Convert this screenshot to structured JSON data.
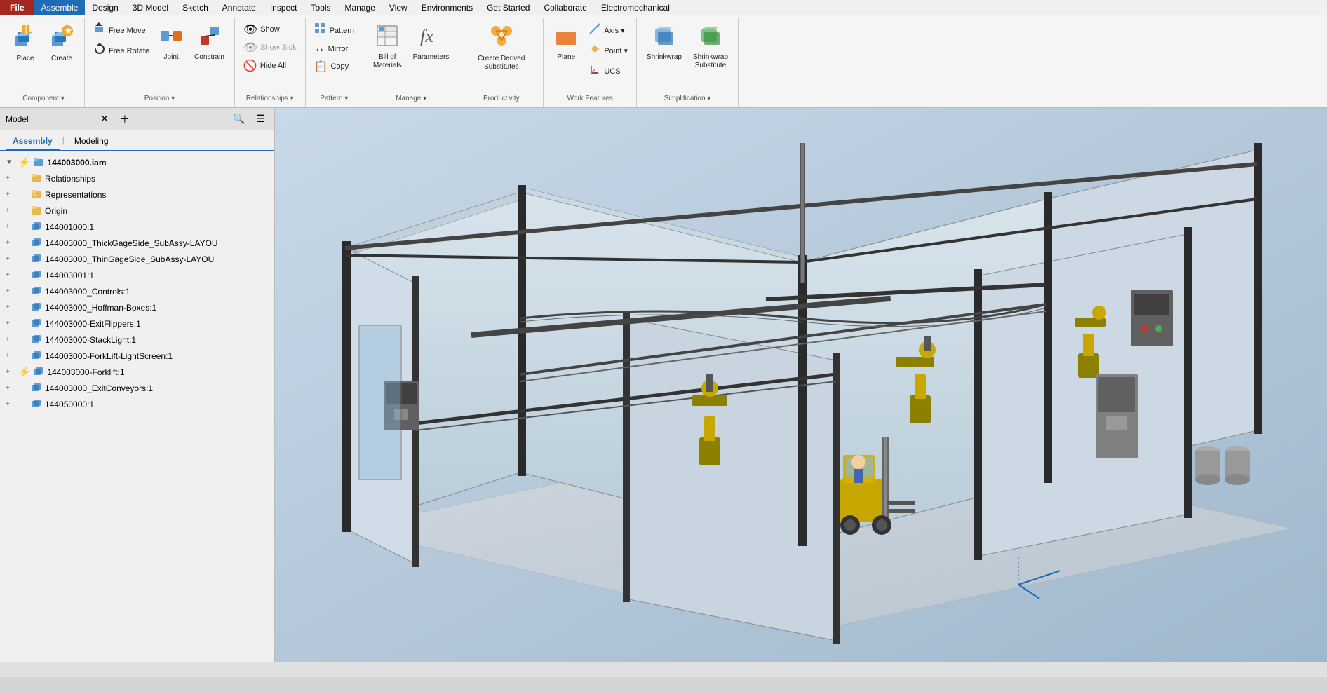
{
  "menubar": {
    "file": "File",
    "items": [
      "Assemble",
      "Design",
      "3D Model",
      "Sketch",
      "Annotate",
      "Inspect",
      "Tools",
      "Manage",
      "View",
      "Environments",
      "Get Started",
      "Collaborate",
      "Electromechanical"
    ],
    "active": "Assemble"
  },
  "ribbon": {
    "groups": [
      {
        "label": "Component",
        "items_large": [
          {
            "id": "place",
            "icon": "📦",
            "label": "Place"
          },
          {
            "id": "create",
            "icon": "✨",
            "label": "Create"
          }
        ],
        "items_small": []
      },
      {
        "label": "Position",
        "items_large": [],
        "items_small": [
          {
            "id": "free-move",
            "icon": "⬆️",
            "label": "Free Move"
          },
          {
            "id": "free-rotate",
            "icon": "🔄",
            "label": "Free Rotate"
          },
          {
            "id": "joint",
            "icon": "🔗",
            "label": "Joint"
          },
          {
            "id": "constrain",
            "icon": "📌",
            "label": "Constrain"
          }
        ]
      },
      {
        "label": "Relationships",
        "items_large": [],
        "items_small": [
          {
            "id": "show",
            "icon": "👁️",
            "label": "Show"
          },
          {
            "id": "show-sick",
            "icon": "👁️",
            "label": "Show Sick"
          },
          {
            "id": "hide-all",
            "icon": "🚫",
            "label": "Hide All"
          }
        ]
      },
      {
        "label": "Pattern",
        "items_large": [],
        "items_small": [
          {
            "id": "pattern",
            "icon": "⊞",
            "label": "Pattern"
          },
          {
            "id": "mirror",
            "icon": "↔️",
            "label": "Mirror"
          },
          {
            "id": "copy",
            "icon": "📋",
            "label": "Copy"
          }
        ]
      },
      {
        "label": "Manage",
        "items_large": [
          {
            "id": "bill-of-materials",
            "icon": "📊",
            "label": "Bill of\nMaterials"
          },
          {
            "id": "parameters",
            "icon": "ƒx",
            "label": "Parameters"
          }
        ],
        "items_small": []
      },
      {
        "label": "Productivity",
        "items_large": [
          {
            "id": "create-derived-substitutes",
            "icon": "🔧",
            "label": "Create Derived\nSubstitutes"
          }
        ],
        "items_small": []
      },
      {
        "label": "Work Features",
        "items_large": [
          {
            "id": "plane",
            "icon": "⬜",
            "label": "Plane"
          }
        ],
        "items_small": [
          {
            "id": "axis",
            "icon": "📏",
            "label": "Axis"
          },
          {
            "id": "point",
            "icon": "•",
            "label": "Point"
          },
          {
            "id": "ucs",
            "icon": "📐",
            "label": "UCS"
          }
        ]
      },
      {
        "label": "Simplification",
        "items_large": [
          {
            "id": "shrinkwrap",
            "icon": "🟧",
            "label": "Shrinkwrap"
          },
          {
            "id": "shrinkwrap-substitute",
            "icon": "🟧",
            "label": "Shrinkwrap\nSubstitute"
          }
        ],
        "items_small": []
      }
    ]
  },
  "sidebar": {
    "title": "Model",
    "tabs": [
      "Assembly",
      "Modeling"
    ],
    "active_tab": "Assembly",
    "tree": [
      {
        "id": "root",
        "level": 0,
        "icon": "assembly",
        "label": "144003000.iam",
        "bold": true,
        "special": "bolt"
      },
      {
        "id": "relationships",
        "level": 1,
        "icon": "folder-yellow",
        "label": "Relationships"
      },
      {
        "id": "representations",
        "level": 1,
        "icon": "folder-special",
        "label": "Representations"
      },
      {
        "id": "origin",
        "level": 1,
        "icon": "folder-yellow",
        "label": "Origin"
      },
      {
        "id": "item1",
        "level": 1,
        "icon": "component",
        "label": "144001000:1"
      },
      {
        "id": "item2",
        "level": 1,
        "icon": "component",
        "label": "144003000_ThickGageSide_SubAssy-LAYOU"
      },
      {
        "id": "item3",
        "level": 1,
        "icon": "component",
        "label": "144003000_ThinGageSide_SubAssy-LAYOU"
      },
      {
        "id": "item4",
        "level": 1,
        "icon": "component",
        "label": "144003001:1"
      },
      {
        "id": "item5",
        "level": 1,
        "icon": "component",
        "label": "144003000_Controls:1"
      },
      {
        "id": "item6",
        "level": 1,
        "icon": "component",
        "label": "144003000_Hoffman-Boxes:1"
      },
      {
        "id": "item7",
        "level": 1,
        "icon": "component",
        "label": "144003000-ExitFlippers:1"
      },
      {
        "id": "item8",
        "level": 1,
        "icon": "component",
        "label": "144003000-StackLight:1"
      },
      {
        "id": "item9",
        "level": 1,
        "icon": "component",
        "label": "144003000-ForkLift-LightScreen:1"
      },
      {
        "id": "item10",
        "level": 1,
        "icon": "assembly",
        "label": "144003000-Forklift:1",
        "special": "bolt"
      },
      {
        "id": "item11",
        "level": 1,
        "icon": "component",
        "label": "144003000_ExitConveyors:1"
      },
      {
        "id": "item12",
        "level": 1,
        "icon": "component",
        "label": "144050000:1"
      }
    ]
  },
  "status": {
    "text": ""
  }
}
